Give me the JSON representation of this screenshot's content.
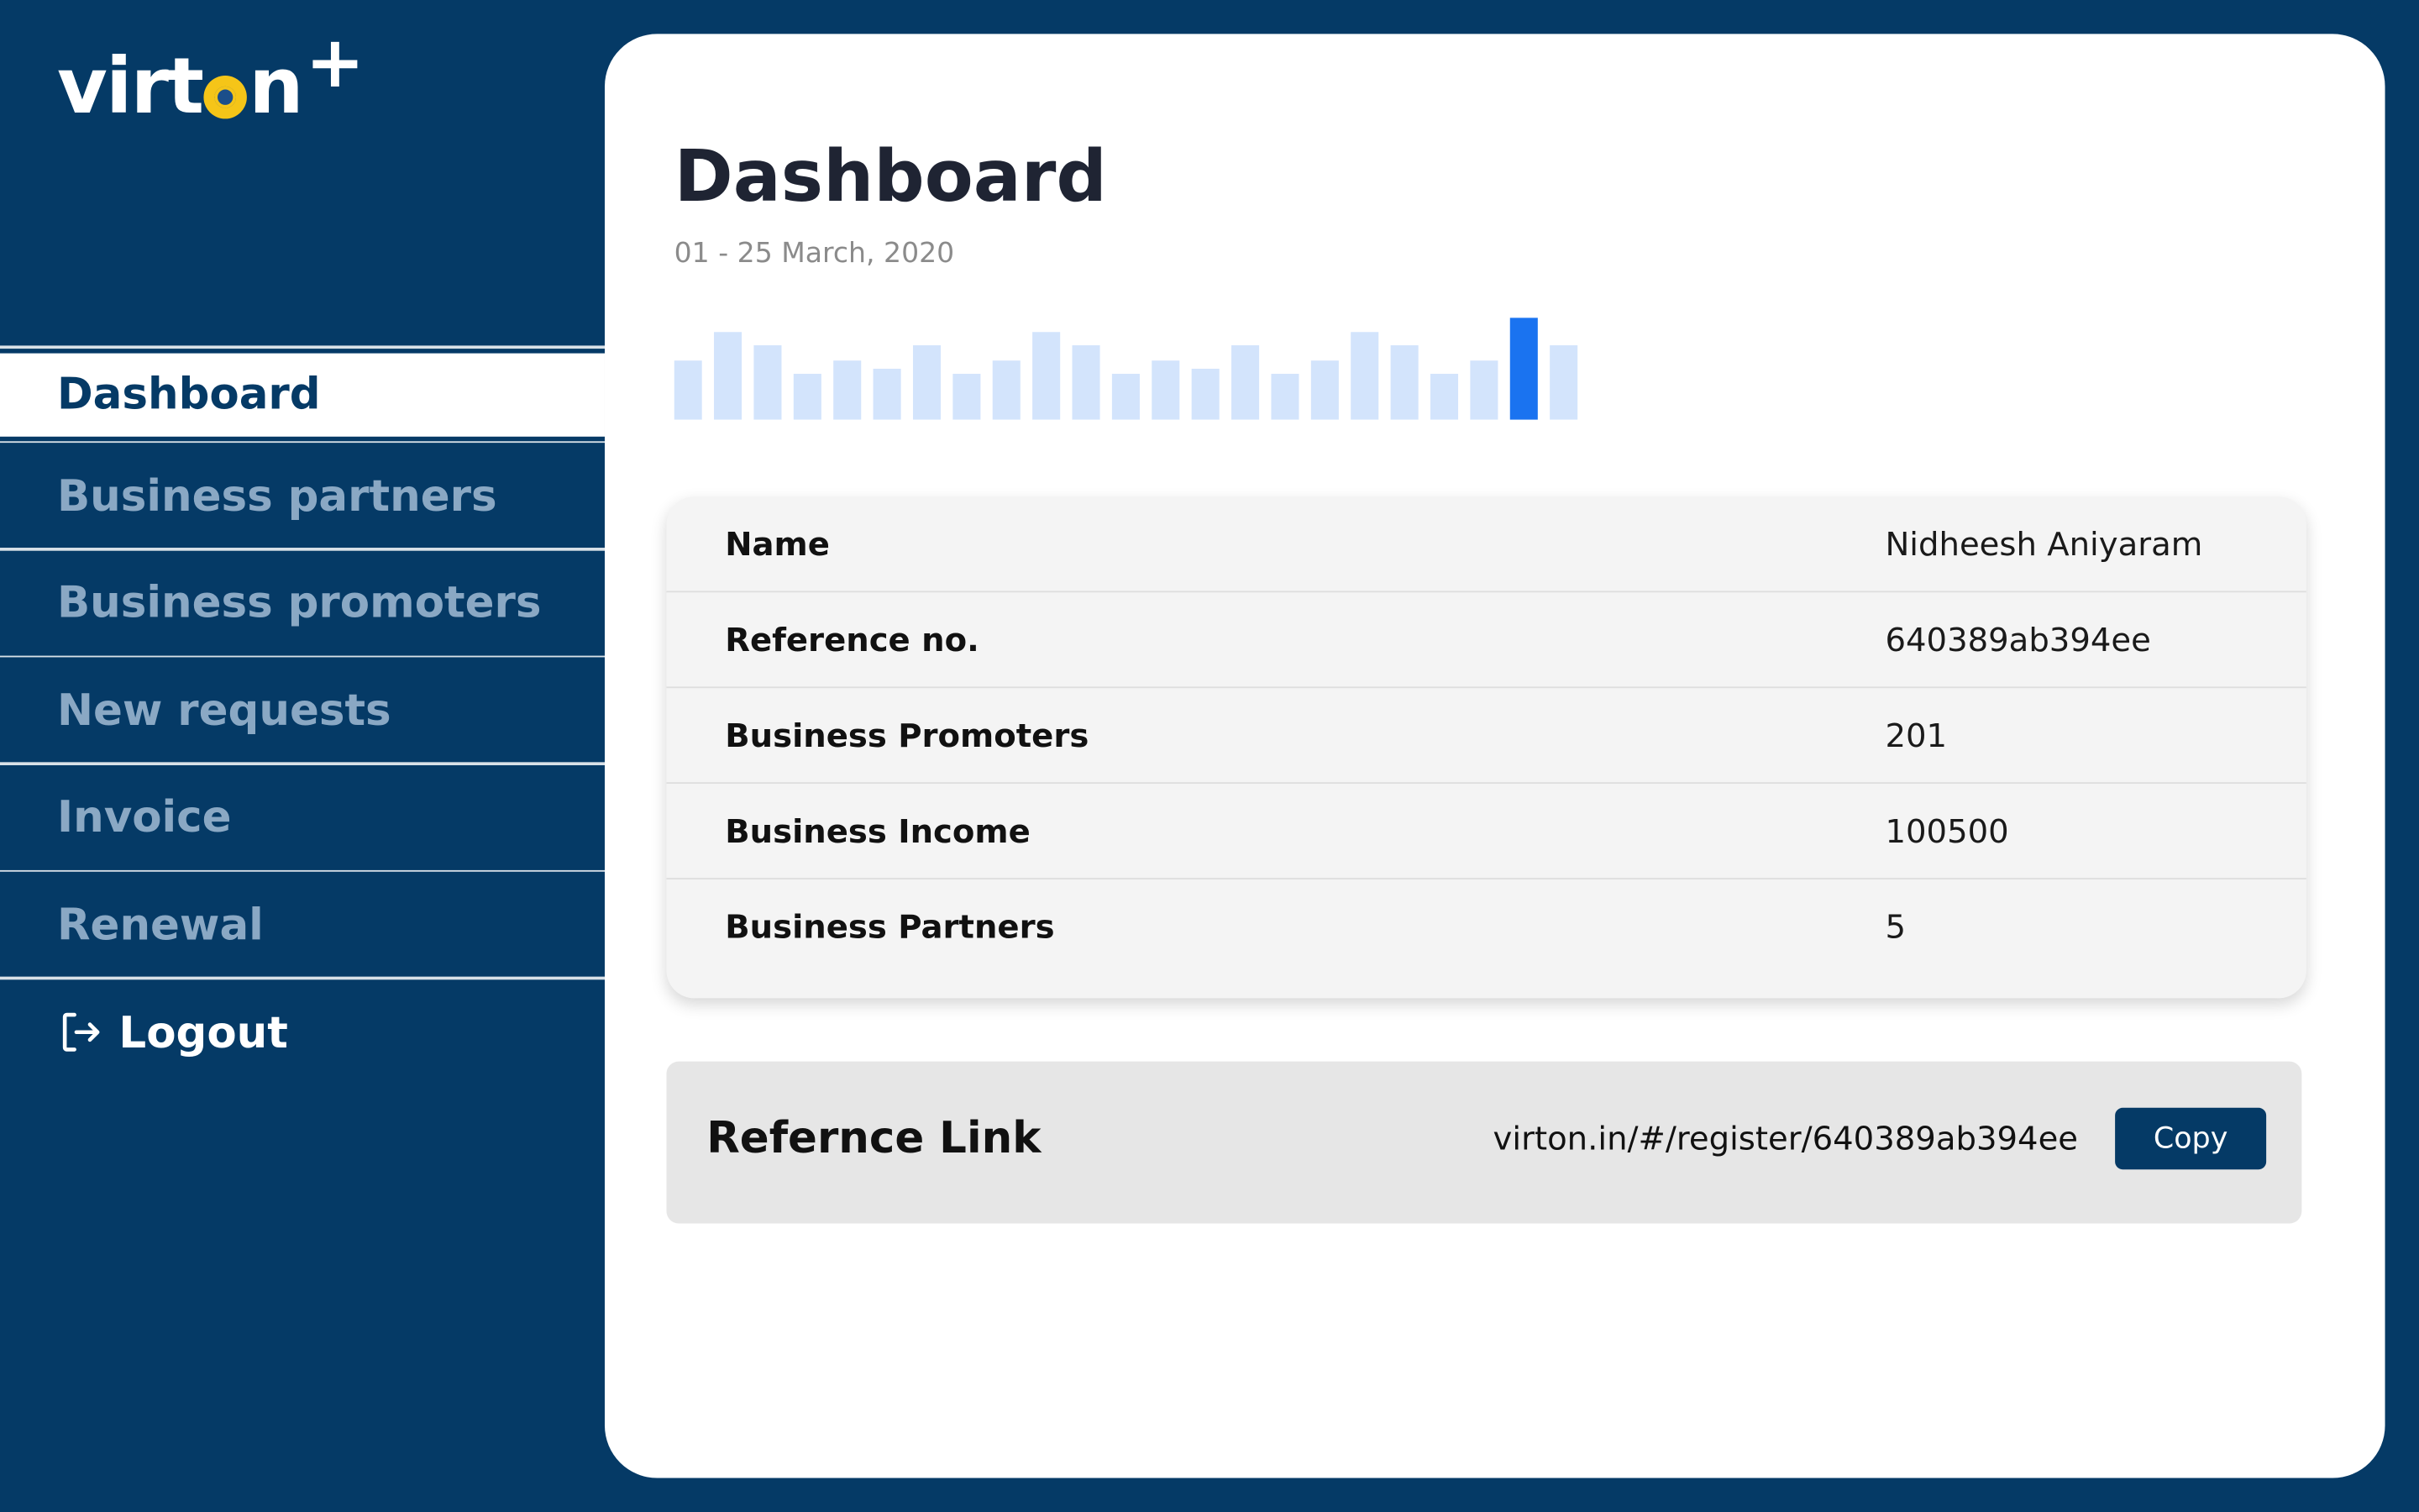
{
  "logo": {
    "text_before": "virt",
    "text_after": "n",
    "plus": "+"
  },
  "sidebar": {
    "items": [
      {
        "label": "Dashboard",
        "active": true
      },
      {
        "label": "Business partners",
        "active": false
      },
      {
        "label": "Business promoters",
        "active": false
      },
      {
        "label": "New requests",
        "active": false
      },
      {
        "label": "Invoice",
        "active": false
      },
      {
        "label": "Renewal",
        "active": false
      }
    ],
    "logout_label": "Logout",
    "logout_icon": "logout-icon"
  },
  "main": {
    "title": "Dashboard",
    "date_range": "01 - 25 March, 2020",
    "activity_chart": {
      "relative_heights": [
        0.58,
        0.86,
        0.73,
        0.45,
        0.58,
        0.5,
        0.73,
        0.45,
        0.58,
        0.86,
        0.73,
        0.45,
        0.58,
        0.5,
        0.73,
        0.45,
        0.58,
        0.86,
        0.73,
        0.45,
        0.58,
        1.0,
        0.73
      ],
      "highlighted_index": 21,
      "bar_color": "#d3e4fc",
      "highlight_color": "#1a73f0"
    },
    "info": [
      {
        "label": "Name",
        "value": "Nidheesh Aniyaram"
      },
      {
        "label": "Reference no.",
        "value": "640389ab394ee"
      },
      {
        "label": "Business Promoters",
        "value": "201"
      },
      {
        "label": "Business Income",
        "value": "100500"
      },
      {
        "label": "Business Partners",
        "value": "5"
      }
    ],
    "reference": {
      "title": "Refernce Link",
      "url": "virton.in/#/register/640389ab394ee",
      "copy_label": "Copy"
    }
  },
  "colors": {
    "sidebar_bg": "#053a66",
    "accent": "#053a66",
    "muted_nav": "#8aa8c4",
    "logo_yellow": "#f5c518"
  }
}
